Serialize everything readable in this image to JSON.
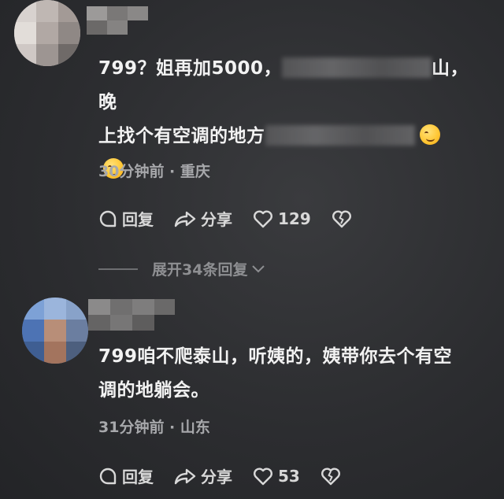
{
  "comments": [
    {
      "text_part1": "799？姐再加5000，",
      "text_part2": "山，晚",
      "text_line2": "上找个有空调的地方",
      "meta": "30分钟前 · 重庆",
      "reply_label": "回复",
      "share_label": "分享",
      "like_count": "129"
    },
    {
      "text_line1": "799咱不爬泰山，听姨的，姨带你去个有空",
      "text_line2": "调的地躺会。",
      "meta": "31分钟前 · 山东",
      "reply_label": "回复",
      "share_label": "分享",
      "like_count": "53"
    }
  ],
  "expand_replies_label": "展开34条回复",
  "colors": {
    "background": "#2c2d30",
    "text": "#f2f2f2",
    "meta": "#a7a8ab",
    "emoji": "#ffc531"
  }
}
